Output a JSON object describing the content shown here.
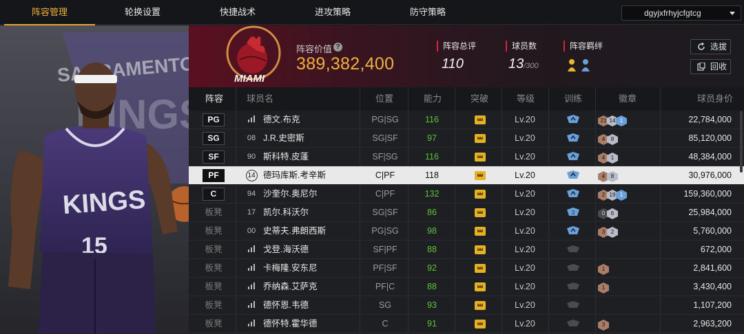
{
  "nav": {
    "tabs": [
      {
        "label": "阵容管理",
        "active": true
      },
      {
        "label": "轮换设置",
        "active": false
      },
      {
        "label": "快捷战术",
        "active": false
      },
      {
        "label": "进攻策略",
        "active": false
      },
      {
        "label": "防守策略",
        "active": false
      }
    ],
    "account": "dgyjxfrhyjcfgtcg"
  },
  "team": {
    "logo_text": "MIAMI",
    "value_label": "阵容价值",
    "value": "389,382,400",
    "rating_label": "阵容总评",
    "rating": "110",
    "players_label": "球员数",
    "players": "13",
    "players_max": "/300",
    "bond_label": "阵容羁绊",
    "draft_button": "选拔",
    "recycle_button": "回收",
    "accent_color": "#f0b13a",
    "brand_red": "#d3263b"
  },
  "table": {
    "headers": [
      "阵容",
      "球员名",
      "位置",
      "能力",
      "突破",
      "等级",
      "训练",
      "徽章",
      "球员身价"
    ],
    "rows": [
      {
        "slot": "PG",
        "starter": true,
        "num": "",
        "name": "德文.布克",
        "pos": "PG|SG",
        "ability": "116",
        "level": "Lv.20",
        "training": "up",
        "badges": [
          [
            "bronze",
            "21"
          ],
          [
            "silver",
            "14"
          ],
          [
            "gold",
            "1"
          ]
        ],
        "value": "22,784,000"
      },
      {
        "slot": "SG",
        "starter": true,
        "num": "08",
        "name": "J.R.史密斯",
        "pos": "SG|SF",
        "ability": "97",
        "level": "Lv.20",
        "training": "up",
        "badges": [
          [
            "bronze",
            "4"
          ],
          [
            "silver",
            "8"
          ]
        ],
        "value": "85,120,000"
      },
      {
        "slot": "SF",
        "starter": true,
        "num": "90",
        "name": "斯科特.皮蓬",
        "pos": "SF|SG",
        "ability": "116",
        "level": "Lv.20",
        "training": "up",
        "badges": [
          [
            "bronze",
            "4"
          ],
          [
            "silver",
            "1"
          ]
        ],
        "value": "48,384,000"
      },
      {
        "slot": "PF",
        "starter": true,
        "selected": true,
        "num": "14",
        "name": "德玛库斯.考辛斯",
        "pos": "C|PF",
        "ability": "118",
        "level": "Lv.20",
        "training": "up",
        "badges": [
          [
            "bronze",
            "4"
          ],
          [
            "silver",
            "8"
          ]
        ],
        "value": "30,976,000"
      },
      {
        "slot": "C",
        "starter": true,
        "num": "94",
        "name": "沙奎尔.奥尼尔",
        "pos": "C|PF",
        "ability": "132",
        "level": "Lv.20",
        "training": "up",
        "badges": [
          [
            "bronze",
            "2"
          ],
          [
            "silver",
            "19"
          ],
          [
            "gold",
            "1"
          ]
        ],
        "value": "159,360,000"
      },
      {
        "slot": "板凳",
        "starter": false,
        "num": "17",
        "name": "凯尔.科沃尔",
        "pos": "SG|SF",
        "ability": "86",
        "level": "Lv.20",
        "training": "3",
        "badges": [
          [
            "dark",
            "0"
          ],
          [
            "silver",
            "6"
          ]
        ],
        "value": "25,984,000"
      },
      {
        "slot": "板凳",
        "starter": false,
        "num": "00",
        "name": "史蒂夫.弗朗西斯",
        "pos": "PG|SG",
        "ability": "98",
        "level": "Lv.20",
        "training": "up",
        "badges": [
          [
            "bronze",
            "3"
          ],
          [
            "silver",
            "2"
          ]
        ],
        "value": "5,760,000"
      },
      {
        "slot": "板凳",
        "starter": false,
        "num": "",
        "name": "戈登.海沃德",
        "pos": "SF|PF",
        "ability": "88",
        "level": "Lv.20",
        "training": "none",
        "badges": [],
        "value": "672,000"
      },
      {
        "slot": "板凳",
        "starter": false,
        "num": "",
        "name": "卡梅隆.安东尼",
        "pos": "PF|SF",
        "ability": "92",
        "level": "Lv.20",
        "training": "none",
        "badges": [
          [
            "bronze",
            "1"
          ]
        ],
        "value": "2,841,600"
      },
      {
        "slot": "板凳",
        "starter": false,
        "num": "",
        "name": "乔纳森.艾萨克",
        "pos": "PF|C",
        "ability": "88",
        "level": "Lv.20",
        "training": "none",
        "badges": [
          [
            "bronze",
            "1"
          ]
        ],
        "value": "3,430,400"
      },
      {
        "slot": "板凳",
        "starter": false,
        "num": "",
        "name": "德怀恩.韦德",
        "pos": "SG",
        "ability": "93",
        "level": "Lv.20",
        "training": "none",
        "badges": [],
        "value": "1,107,200"
      },
      {
        "slot": "板凳",
        "starter": false,
        "num": "",
        "name": "德怀特.霍华德",
        "pos": "C",
        "ability": "91",
        "level": "Lv.20",
        "training": "none",
        "badges": [
          [
            "bronze",
            "3"
          ]
        ],
        "value": "2,963,200"
      }
    ]
  },
  "art": {
    "team_text_top": "SACRAMENTO",
    "team_text_big": "KINGS",
    "jersey_text": "KINGS",
    "jersey_number": "15"
  }
}
